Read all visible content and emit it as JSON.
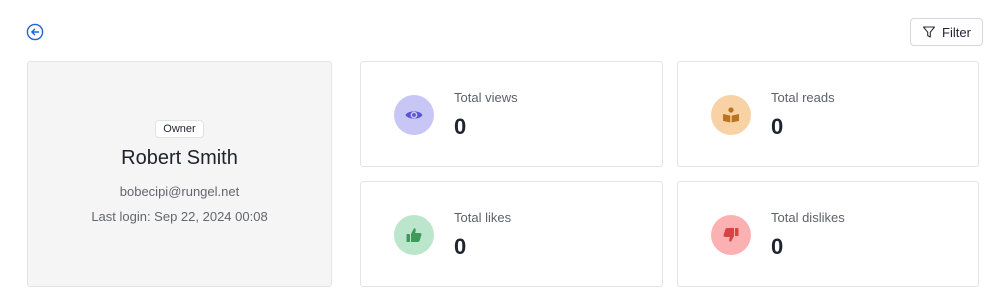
{
  "header": {
    "back_icon": "arrow-left-circle-icon",
    "filter_label": "Filter",
    "filter_icon": "funnel-icon"
  },
  "profile": {
    "role": "Owner",
    "name": "Robert Smith",
    "email": "bobecipi@rungel.net",
    "last_login": "Last login: Sep 22, 2024 00:08"
  },
  "stats": {
    "views": {
      "label": "Total views",
      "value": "0",
      "icon": "eye-icon",
      "bg_color": "#c7c6f5",
      "icon_color": "#5b55d6"
    },
    "reads": {
      "label": "Total reads",
      "value": "0",
      "icon": "book-reader-icon",
      "bg_color": "#f8d2a4",
      "icon_color": "#b8741f"
    },
    "likes": {
      "label": "Total likes",
      "value": "0",
      "icon": "thumbs-up-icon",
      "bg_color": "#bce6cb",
      "icon_color": "#3e9a5a"
    },
    "dislikes": {
      "label": "Total dislikes",
      "value": "0",
      "icon": "thumbs-down-icon",
      "bg_color": "#fbb1b1",
      "icon_color": "#d64545"
    }
  },
  "colors": {
    "accent": "#1f63d6",
    "card_border": "#e2e4e7",
    "profile_bg": "#f5f5f5"
  }
}
